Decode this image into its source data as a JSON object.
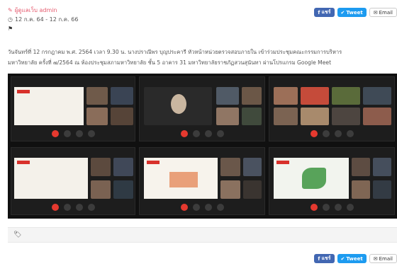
{
  "post": {
    "author": "ผู้ดูแลเว็บ admin",
    "date": "12 ก.ค. 64 - 12 ก.ค. 66",
    "description_line1": "วันจันทร์ที่ 12 กรกฎาคม พ.ศ. 2564 เวลา 9.30 น. นางปราณีพร บุญประคารี หัวหน้าหน่วยตรวจสอบภายใน เข้าร่วมประชุมคณะกรรมการบริหาร",
    "description_line2": "มหาวิทยาลัย ครั้งที่ ๗/2564 ณ ห้องประชุมสภามหาวิทยาลัย ชั้น 5 อาคาร 31 มหาวิทยาลัยราชภัฏสวนสุนันทา ผ่านโปรแกรม Google Meet"
  },
  "share": {
    "facebook_label": "แชร์",
    "tweet_label": "Tweet",
    "email_label": "Email"
  },
  "icons": {
    "author": "pencil-icon",
    "date": "clock-icon",
    "flag": "flag-icon",
    "tag": "tag-icon"
  },
  "colors": {
    "facebook": "#4267b2",
    "twitter": "#1d9bf0",
    "author": "#e55a6e",
    "end_call": "#e5392f"
  }
}
